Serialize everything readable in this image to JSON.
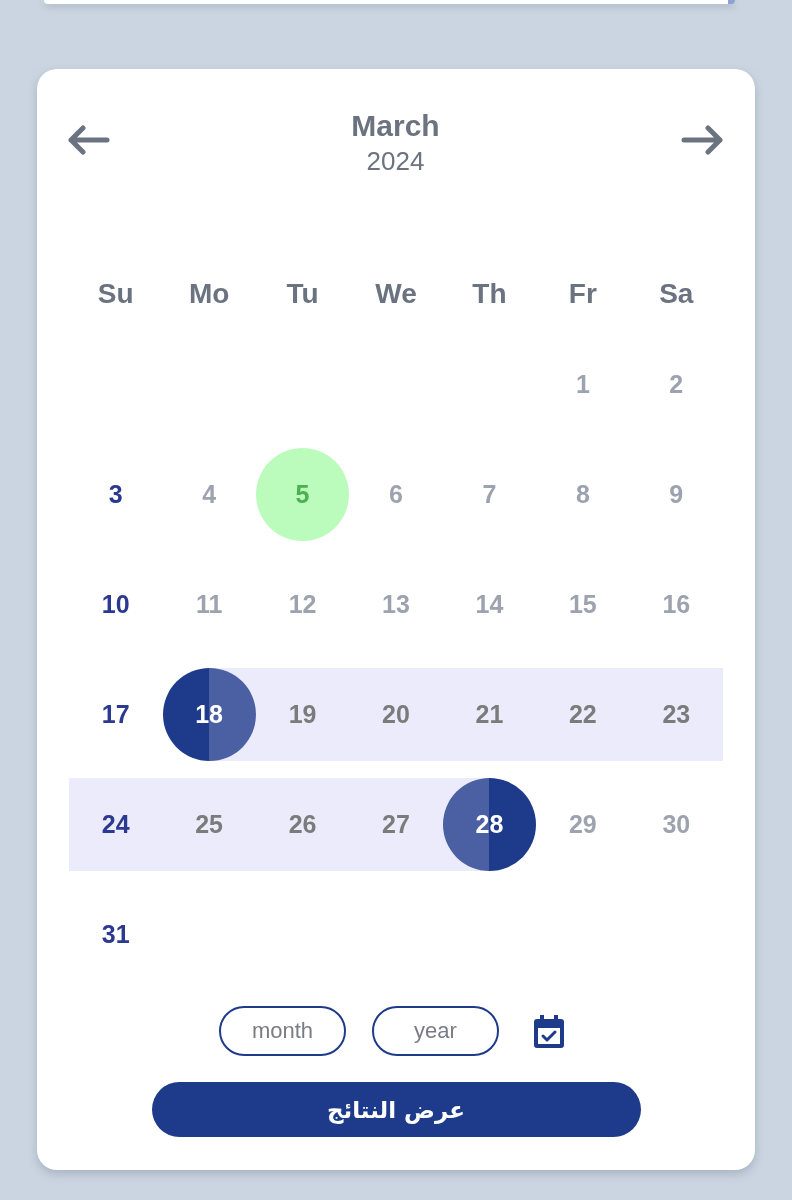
{
  "calendar": {
    "month": "March",
    "year": "2024",
    "weekdays": [
      {
        "label": "Su",
        "holiday": true
      },
      {
        "label": "Mo",
        "holiday": false
      },
      {
        "label": "Tu",
        "holiday": false
      },
      {
        "label": "We",
        "holiday": false
      },
      {
        "label": "Th",
        "holiday": false
      },
      {
        "label": "Fr",
        "holiday": false
      },
      {
        "label": "Sa",
        "holiday": false
      }
    ],
    "weeks": [
      {
        "days": [
          {
            "label": "1",
            "today": false,
            "selected": false,
            "in_range": false
          },
          {
            "label": "2",
            "today": false,
            "selected": false,
            "in_range": false
          }
        ]
      },
      {
        "days": [
          {
            "label": "3",
            "today": false,
            "selected": false,
            "in_range": false
          },
          {
            "label": "4",
            "today": false,
            "selected": false,
            "in_range": false
          },
          {
            "label": "5",
            "today": true,
            "selected": false,
            "in_range": false
          },
          {
            "label": "6",
            "today": false,
            "selected": false,
            "in_range": false
          },
          {
            "label": "7",
            "today": false,
            "selected": false,
            "in_range": false
          },
          {
            "label": "8",
            "today": false,
            "selected": false,
            "in_range": false
          },
          {
            "label": "9",
            "today": false,
            "selected": false,
            "in_range": false
          }
        ]
      },
      {
        "days": [
          {
            "label": "10",
            "today": false,
            "selected": false,
            "in_range": false
          },
          {
            "label": "11",
            "today": false,
            "selected": false,
            "in_range": false
          },
          {
            "label": "12",
            "today": false,
            "selected": false,
            "in_range": false
          },
          {
            "label": "13",
            "today": false,
            "selected": false,
            "in_range": false
          },
          {
            "label": "14",
            "today": false,
            "selected": false,
            "in_range": false
          },
          {
            "label": "15",
            "today": false,
            "selected": false,
            "in_range": false
          },
          {
            "label": "16",
            "today": false,
            "selected": false,
            "in_range": false
          }
        ]
      },
      {
        "days": [
          {
            "label": "17",
            "today": false,
            "selected": false,
            "in_range": false
          },
          {
            "label": "18",
            "today": false,
            "selected": true,
            "in_range": true
          },
          {
            "label": "19",
            "today": false,
            "selected": false,
            "in_range": true
          },
          {
            "label": "20",
            "today": false,
            "selected": false,
            "in_range": true
          },
          {
            "label": "21",
            "today": false,
            "selected": false,
            "in_range": true
          },
          {
            "label": "22",
            "today": false,
            "selected": false,
            "in_range": true
          },
          {
            "label": "23",
            "today": false,
            "selected": false,
            "in_range": true
          }
        ]
      },
      {
        "days": [
          {
            "label": "24",
            "today": false,
            "selected": false,
            "in_range": true
          },
          {
            "label": "25",
            "today": false,
            "selected": false,
            "in_range": true
          },
          {
            "label": "26",
            "today": false,
            "selected": false,
            "in_range": true
          },
          {
            "label": "27",
            "today": false,
            "selected": false,
            "in_range": true
          },
          {
            "label": "28",
            "today": false,
            "selected": true,
            "in_range": true
          },
          {
            "label": "29",
            "today": false,
            "selected": false,
            "in_range": false
          },
          {
            "label": "30",
            "today": false,
            "selected": false,
            "in_range": false
          }
        ]
      },
      {
        "days": [
          {
            "label": "31",
            "today": false,
            "selected": false,
            "in_range": false
          }
        ]
      }
    ]
  },
  "filter": {
    "month_field": {
      "placeholder": "month"
    },
    "year_field": {
      "placeholder": "year"
    },
    "submit_button": "عرض النتائج"
  }
}
